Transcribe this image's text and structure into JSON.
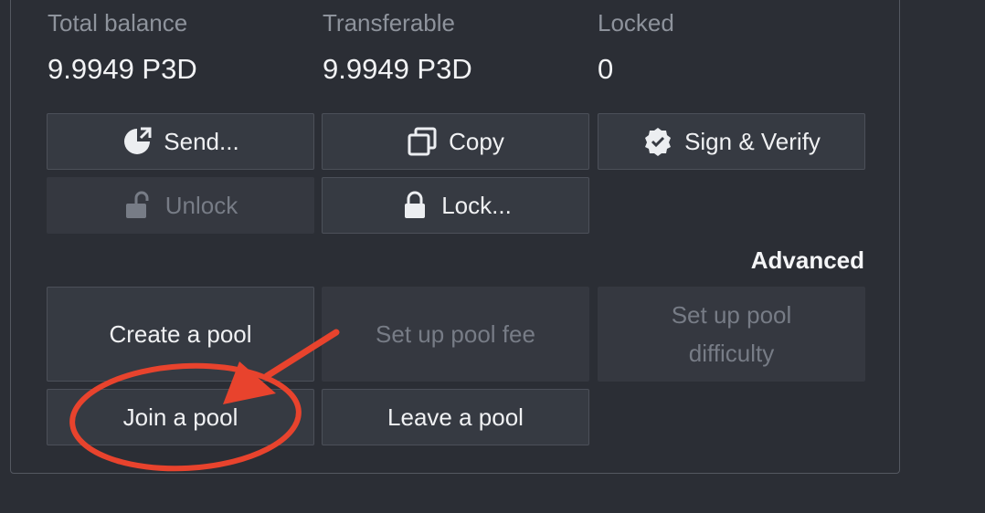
{
  "balances": {
    "total_label": "Total balance",
    "total_value": "9.9949 P3D",
    "transferable_label": "Transferable",
    "transferable_value": "9.9949 P3D",
    "locked_label": "Locked",
    "locked_value": "0"
  },
  "actions": {
    "send_label": "Send...",
    "copy_label": "Copy",
    "sign_verify_label": "Sign & Verify",
    "unlock_label": "Unlock",
    "lock_label": "Lock..."
  },
  "advanced": {
    "title": "Advanced",
    "create_pool_label": "Create a pool",
    "set_pool_fee_label": "Set up pool fee",
    "set_pool_difficulty_label": "Set up pool difficulty",
    "join_pool_label": "Join a pool",
    "leave_pool_label": "Leave a pool"
  },
  "icons": {
    "send": "send-icon",
    "copy": "copy-icon",
    "sign_verify": "verified-badge-icon",
    "unlock": "unlock-icon",
    "lock": "lock-icon"
  },
  "colors": {
    "annotation": "#e8432d",
    "background": "#2b2e35",
    "button": "#363a42"
  }
}
